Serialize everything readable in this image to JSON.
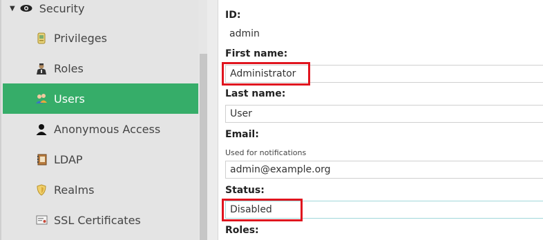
{
  "sidebar": {
    "section": {
      "label": "Security",
      "icon": "eye-icon"
    },
    "items": [
      {
        "label": "Privileges",
        "icon": "badge-icon",
        "active": false
      },
      {
        "label": "Roles",
        "icon": "user-suit-icon",
        "active": false
      },
      {
        "label": "Users",
        "icon": "users-icon",
        "active": true
      },
      {
        "label": "Anonymous Access",
        "icon": "person-silhouette-icon",
        "active": false
      },
      {
        "label": "LDAP",
        "icon": "address-book-icon",
        "active": false
      },
      {
        "label": "Realms",
        "icon": "shield-icon",
        "active": false
      },
      {
        "label": "SSL Certificates",
        "icon": "certificate-icon",
        "active": false
      }
    ]
  },
  "form": {
    "id": {
      "label": "ID:",
      "value": "admin"
    },
    "first_name": {
      "label": "First name:",
      "value": "Administrator"
    },
    "last_name": {
      "label": "Last name:",
      "value": "User"
    },
    "email": {
      "label": "Email:",
      "hint": "Used for notifications",
      "value": "admin@example.org"
    },
    "status": {
      "label": "Status:",
      "value": "Disabled"
    },
    "roles": {
      "label": "Roles:"
    }
  },
  "colors": {
    "active_item": "#36ad69",
    "annotation_red": "#e0141e",
    "status_border": "#9fd7d9"
  }
}
